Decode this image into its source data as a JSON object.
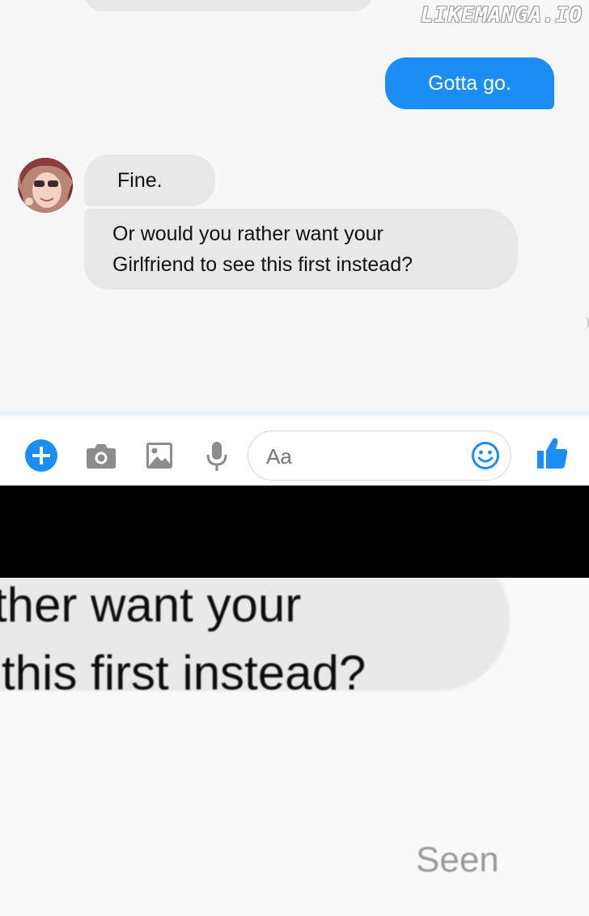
{
  "watermark": "LIKEMANGA.IO",
  "messages": {
    "outgoing": [
      {
        "text": "Gotta go."
      }
    ],
    "incoming": [
      {
        "text": "Fine."
      },
      {
        "lines": [
          "Or would you rather want your",
          "Girlfriend to see this first instead?"
        ]
      }
    ]
  },
  "composer": {
    "placeholder": "Aa",
    "icons": [
      "plus-icon",
      "camera-icon",
      "image-icon",
      "microphone-icon",
      "emoji-icon",
      "thumbs-up-icon"
    ],
    "accent_color": "#1a8ef5"
  },
  "zoom_panel": {
    "lines": [
      "ther want your",
      "this first instead?"
    ],
    "status": "Seen"
  }
}
